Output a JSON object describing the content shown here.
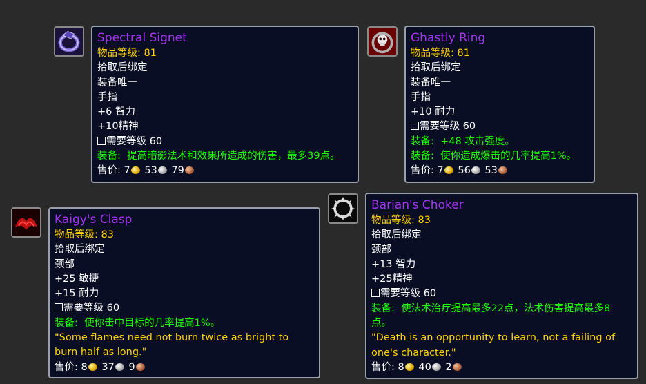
{
  "items": [
    {
      "name": "Spectral Signet",
      "ilvl": "物品等级: 81",
      "binding": "拾取后绑定",
      "unique": "装备唯一",
      "slot": "手指",
      "stat1": "+6 智力",
      "stat2": "+10精神",
      "req": "需要等级 60",
      "equip_label": "装备:",
      "equip_text": "提高暗影法术和效果所造成的伤害，最多39点。",
      "sell_label": "售价:",
      "gold": "7",
      "silver": "53",
      "copper": "79",
      "icon": "spectral-ring-icon"
    },
    {
      "name": "Ghastly Ring",
      "ilvl": "物品等级: 81",
      "binding": "拾取后绑定",
      "unique": "装备唯一",
      "slot": "手指",
      "stat1": "+10 耐力",
      "req": "需要等级 60",
      "equip1_label": "装备:",
      "equip1_text": "+48 攻击强度。",
      "equip2_label": "装备:",
      "equip2_text": "使你造成爆击的几率提高1%。",
      "sell_label": "售价:",
      "gold": "7",
      "silver": "56",
      "copper": "53",
      "icon": "skull-ring-icon"
    },
    {
      "name": "Kaigy's Clasp",
      "ilvl": "物品等级: 83",
      "binding": "拾取后绑定",
      "slot": "颈部",
      "stat1": "+25 敏捷",
      "stat2": "+15 耐力",
      "req": "需要等级 60",
      "equip_label": "装备:",
      "equip_text": "使你击中目标的几率提高1%。",
      "flavor_line1": "\"Some flames need not burn twice as bright to",
      "flavor_line2": "burn half as long.\"",
      "sell_label": "售价:",
      "gold": "8",
      "silver": "37",
      "copper": "9",
      "icon": "red-clasp-icon"
    },
    {
      "name": "Barian's Choker",
      "ilvl": "物品等级: 83",
      "binding": "拾取后绑定",
      "slot": "颈部",
      "stat1": "+13 智力",
      "stat2": "+25精神",
      "req": "需要等级 60",
      "equip_label": "装备:",
      "equip_text_line1": "使法术治疗提高最多22点，法术伤害提高最多8",
      "equip_text_line2": "点。",
      "flavor_line1": "\"Death is an opportunity to learn, not a failing of",
      "flavor_line2": "one's character.\"",
      "sell_label": "售价:",
      "gold": "8",
      "silver": "40",
      "copper": "2",
      "icon": "spiked-choker-icon"
    }
  ]
}
